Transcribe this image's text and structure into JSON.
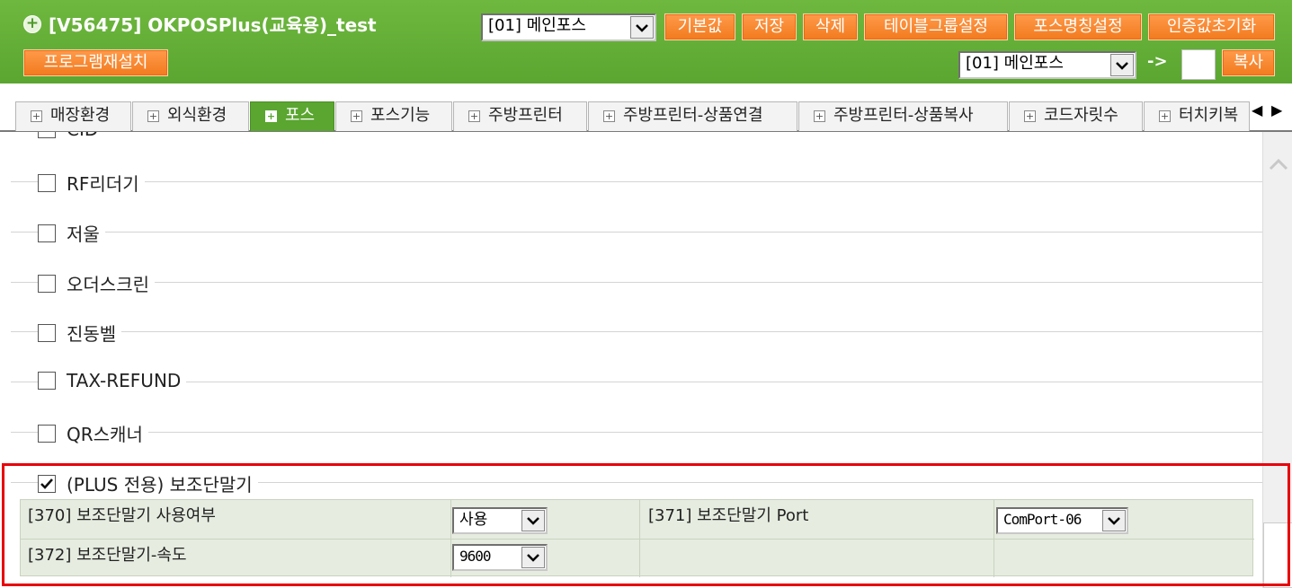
{
  "header": {
    "title": "[V56475] OKPOSPlus(교육용)_test",
    "pos_select": "[01] 메인포스",
    "buttons": [
      "기본값",
      "저장",
      "삭제",
      "테이블그룹설정",
      "포스명칭설정",
      "인증값초기화"
    ],
    "reinstall_label": "프로그램재설치",
    "copy_source_select": "[01] 메인포스",
    "copy_arrow": "->",
    "copy_label": "복사"
  },
  "tabs": [
    {
      "label": "매장환경",
      "active": false
    },
    {
      "label": "외식환경",
      "active": false
    },
    {
      "label": "포스",
      "active": true
    },
    {
      "label": "포스기능",
      "active": false
    },
    {
      "label": "주방프린터",
      "active": false
    },
    {
      "label": "주방프린터-상품연결",
      "active": false
    },
    {
      "label": "주방프린터-상품복사",
      "active": false
    },
    {
      "label": "코드자릿수",
      "active": false
    },
    {
      "label": "터치키복",
      "active": false
    }
  ],
  "groups": [
    {
      "label": "CID",
      "checked": false
    },
    {
      "label": "RF리더기",
      "checked": false
    },
    {
      "label": "저울",
      "checked": false
    },
    {
      "label": "오더스크린",
      "checked": false
    },
    {
      "label": "진동벨",
      "checked": false
    },
    {
      "label": "TAX-REFUND",
      "checked": false
    },
    {
      "label": "QR스캐너",
      "checked": false
    },
    {
      "label": "(PLUS 전용) 보조단말기",
      "checked": true
    }
  ],
  "settings": {
    "s370_label": "[370] 보조단말기 사용여부",
    "s370_value": "사용",
    "s371_label": "[371] 보조단말기 Port",
    "s371_value": "ComPort-06",
    "s372_label": "[372] 보조단말기-속도",
    "s372_value": "9600"
  },
  "colors": {
    "header_green": "#5aa630",
    "button_orange": "#f27a1e",
    "highlight_red": "#e8000b",
    "settings_bg": "#e6ece0"
  }
}
